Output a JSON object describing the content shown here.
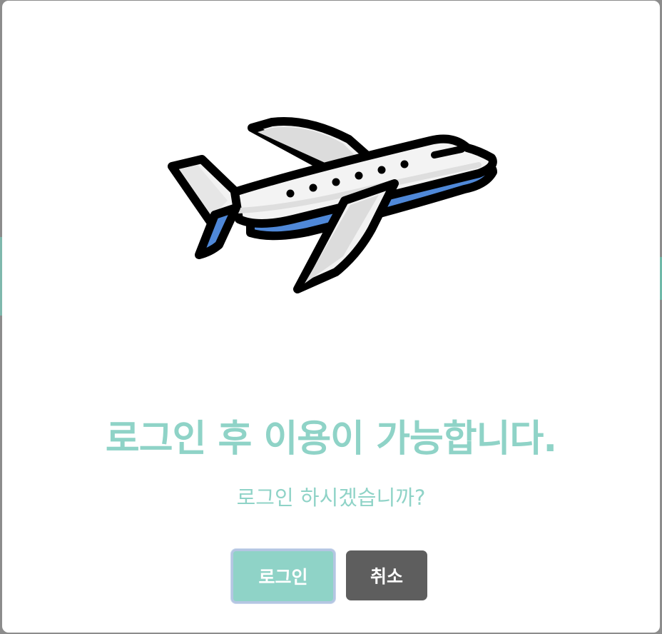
{
  "dialog": {
    "title": "로그인 후 이용이 가능합니다.",
    "message": "로그인 하시겠습니까?",
    "login_button": "로그인",
    "cancel_button": "취소",
    "illustration_icon": "airplane-icon"
  },
  "colors": {
    "accent": "#8fd3c7",
    "cancel": "#5e5e5e",
    "plane_blue": "#4f88d8",
    "backdrop": "#8c8c8c"
  }
}
